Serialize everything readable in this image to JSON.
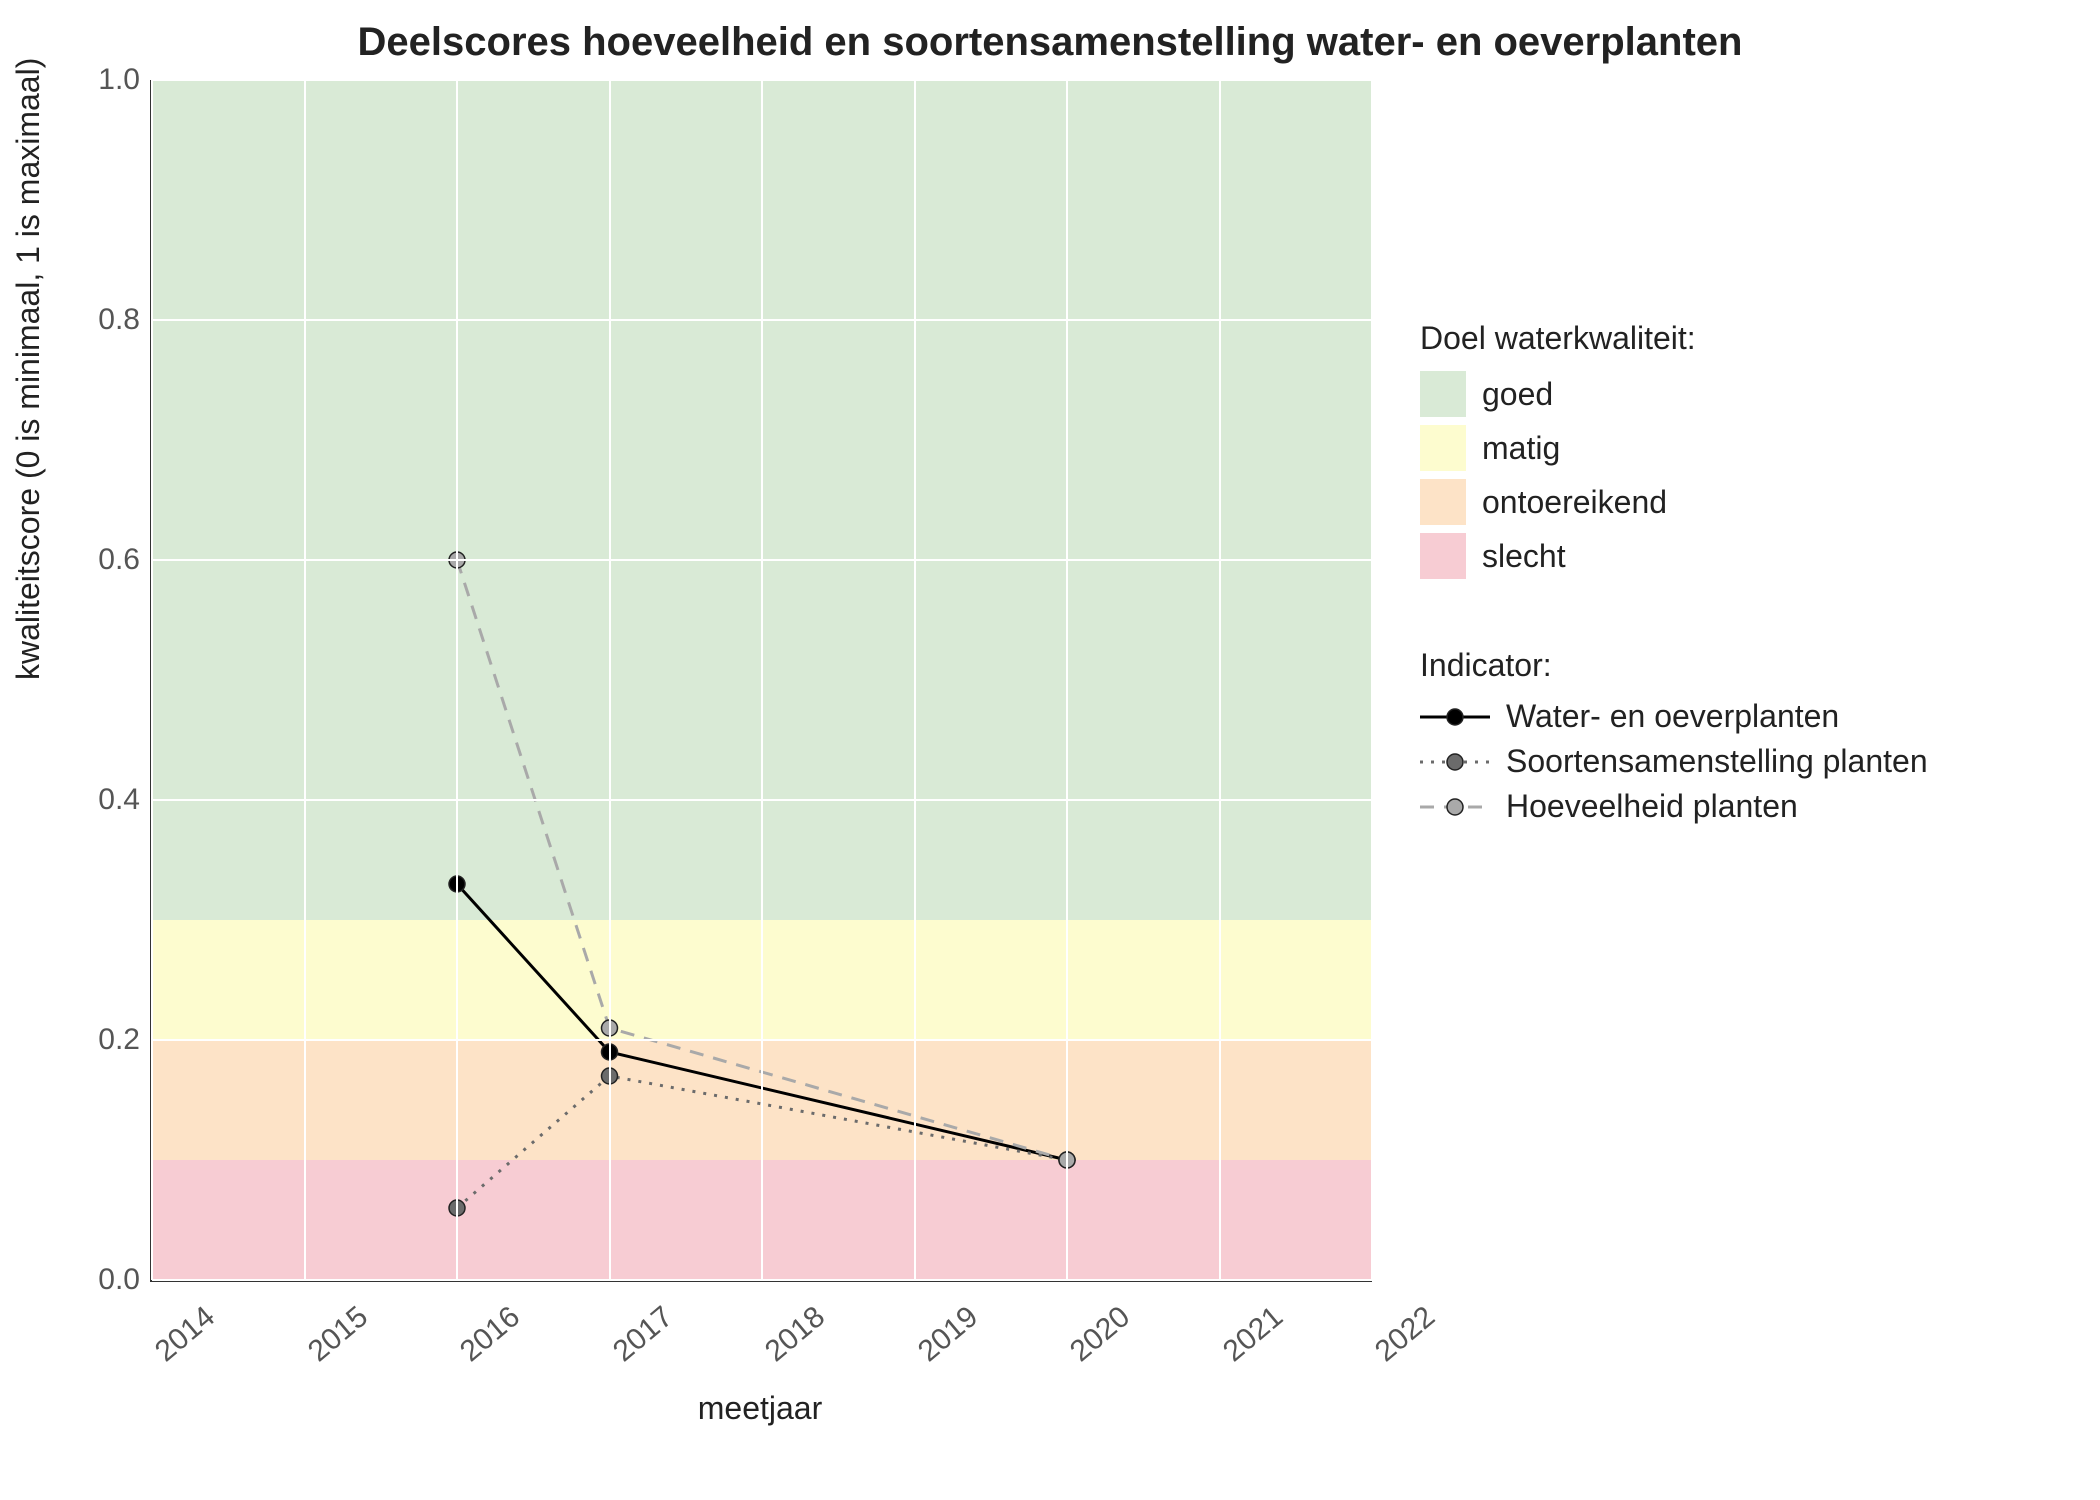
{
  "chart_data": {
    "type": "line",
    "title": "Deelscores hoeveelheid en soortensamenstelling water- en oeverplanten",
    "xlabel": "meetjaar",
    "ylabel": "kwaliteitscore (0 is minimaal, 1 is maximaal)",
    "xlim": [
      2014,
      2022
    ],
    "ylim": [
      0,
      1
    ],
    "xticks": [
      2014,
      2015,
      2016,
      2017,
      2018,
      2019,
      2020,
      2021,
      2022
    ],
    "yticks": [
      0.0,
      0.2,
      0.4,
      0.6,
      0.8,
      1.0
    ],
    "quality_bands": [
      {
        "name": "goed",
        "from": 0.3,
        "to": 1.0,
        "color": "#d9ead6"
      },
      {
        "name": "matig",
        "from": 0.2,
        "to": 0.3,
        "color": "#fdfccf"
      },
      {
        "name": "ontoereikend",
        "from": 0.1,
        "to": 0.2,
        "color": "#fde3c7"
      },
      {
        "name": "slecht",
        "from": 0.0,
        "to": 0.1,
        "color": "#f7ccd3"
      }
    ],
    "x": [
      2016,
      2017,
      2020
    ],
    "series": [
      {
        "name": "Water- en oeverplanten",
        "values": [
          0.33,
          0.19,
          0.1
        ],
        "color": "#000000",
        "dash": "solid",
        "marker_fill": "#000000"
      },
      {
        "name": "Soortensamenstelling planten",
        "values": [
          0.06,
          0.17,
          0.1
        ],
        "color": "#6b6b6b",
        "dash": "dotted",
        "marker_fill": "#6b6b6b"
      },
      {
        "name": "Hoeveelheid planten",
        "values": [
          0.6,
          0.21,
          0.1
        ],
        "color": "#a9a9a9",
        "dash": "dashed",
        "marker_fill": "#a9a9a9"
      }
    ],
    "legend_band_title": "Doel waterkwaliteit:",
    "legend_series_title": "Indicator:"
  }
}
